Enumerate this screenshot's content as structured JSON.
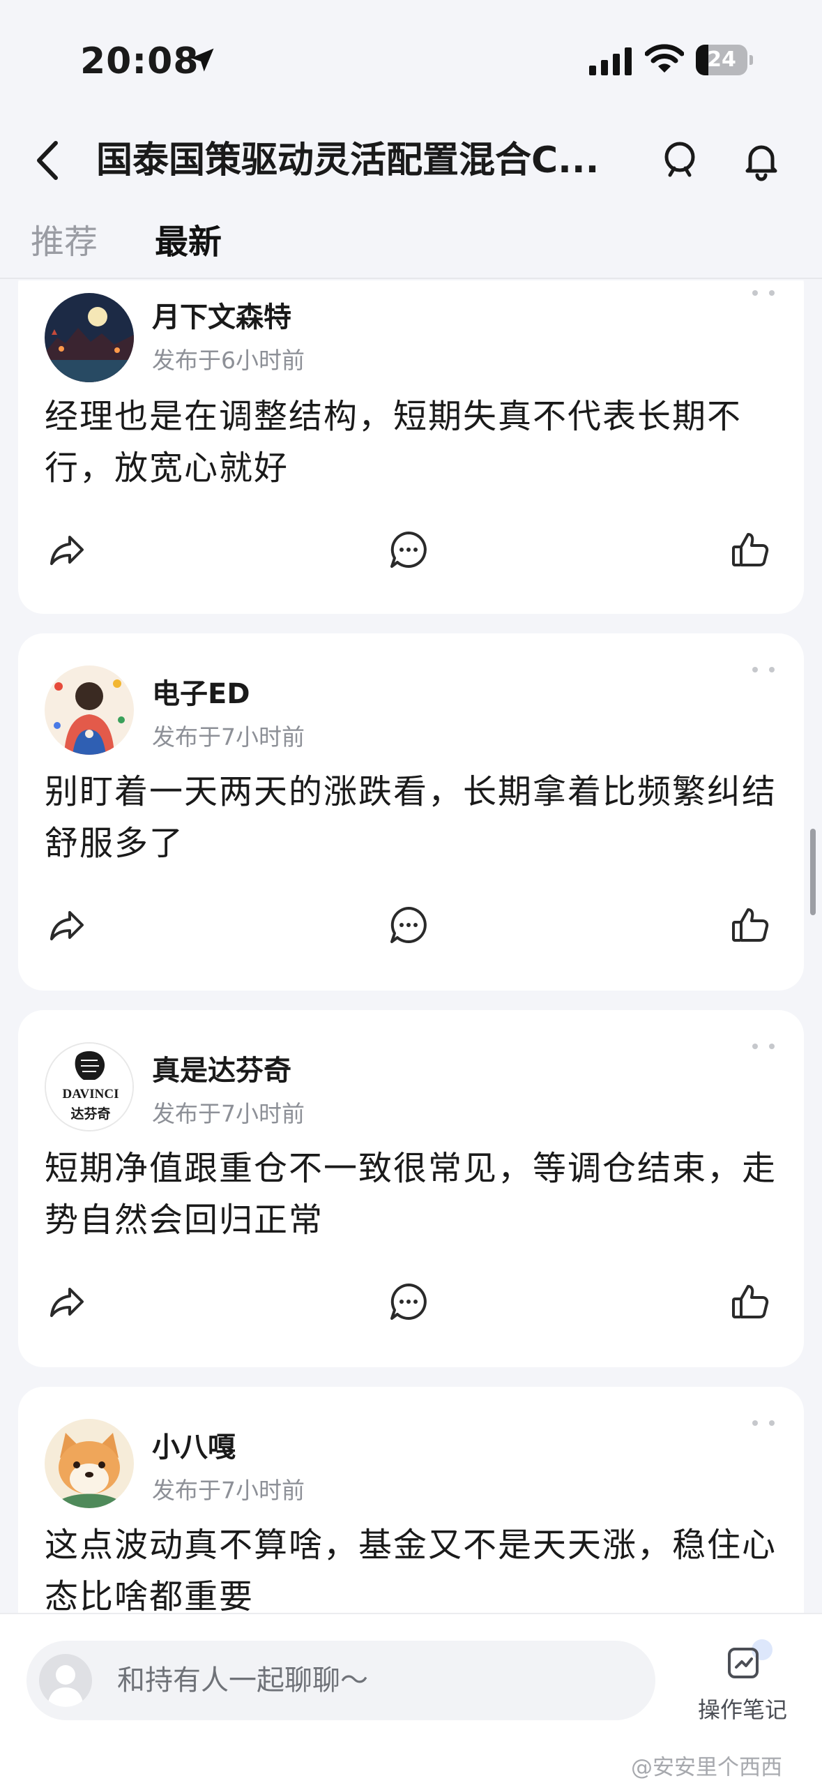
{
  "status_bar": {
    "time": "20:08",
    "battery": "24"
  },
  "header": {
    "title": "国泰国策驱动灵活配置混合C..."
  },
  "tabs": [
    {
      "label": "推荐"
    },
    {
      "label": "最新"
    }
  ],
  "posts": [
    {
      "username": "月下文森特",
      "time": "发布于6小时前",
      "text": "经理也是在调整结构，短期失真不代表长期不行，放宽心就好"
    },
    {
      "username": "电子ED",
      "time": "发布于7小时前",
      "text": "别盯着一天两天的涨跌看，长期拿着比频繁纠结舒服多了"
    },
    {
      "username": "真是达芬奇",
      "time": "发布于7小时前",
      "text": "短期净值跟重仓不一致很常见，等调仓结束，走势自然会回归正常",
      "avatar_text": "DAVINCI",
      "avatar_subtext": "达芬奇"
    },
    {
      "username": "小八嘎",
      "time": "发布于7小时前",
      "text": "这点波动真不算啥，基金又不是天天涨，稳住心态比啥都重要"
    }
  ],
  "bottom_bar": {
    "chat_placeholder": "和持有人一起聊聊～",
    "note_label": "操作笔记"
  },
  "watermark": "@安安里个西西",
  "colors": {
    "background": "#f4f5f9",
    "card": "#ffffff",
    "text_primary": "#1a1a1a",
    "text_secondary": "#8d9097"
  }
}
